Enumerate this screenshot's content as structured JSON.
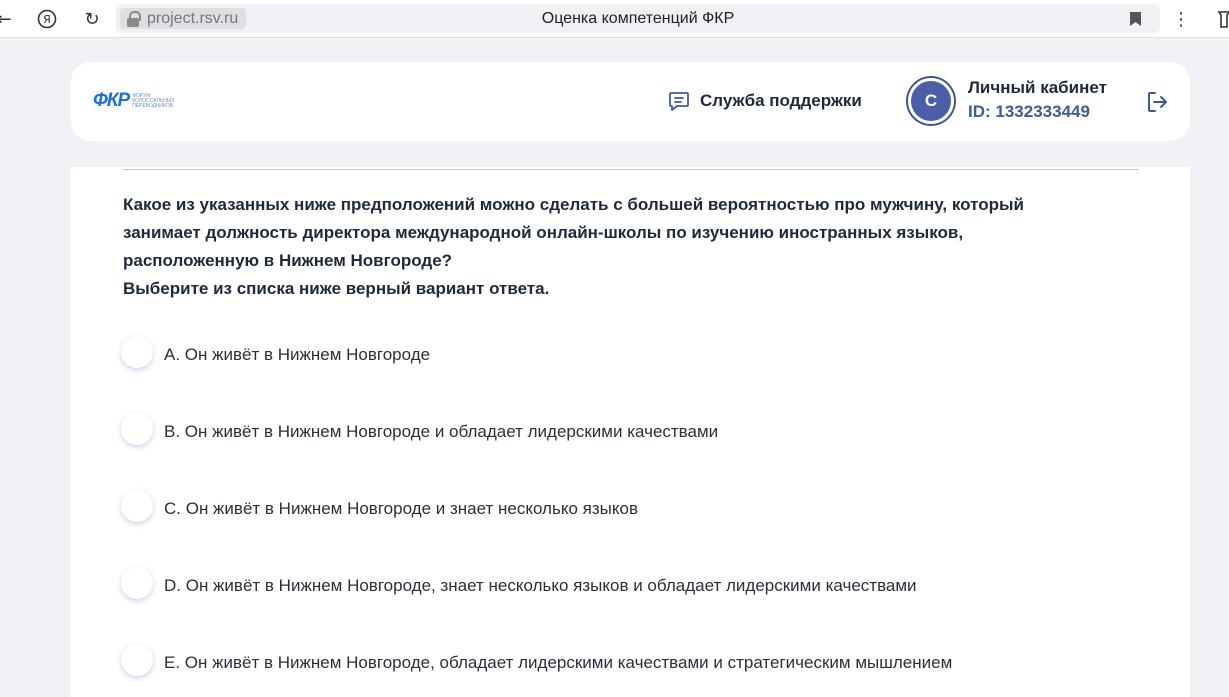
{
  "browser": {
    "url": "project.rsv.ru",
    "tab_title": "Оценка компетенций ФКР"
  },
  "header": {
    "logo_text": "ФКР",
    "logo_subtext": "ФОРУМ КОЛОССАЛЬНЫХ ПЕРЕВОДЧИКОВ",
    "support_label": "Служба поддержки",
    "avatar_letter": "С",
    "cabinet_title": "Личный кабинет",
    "cabinet_id": "ID: 1332333449"
  },
  "question": {
    "text_lines": [
      "Какое из указанных ниже предположений можно сделать с большей вероятностью про мужчину, который",
      "занимает должность директора международной онлайн-школы по изучению иностранных языков,",
      "расположенную в Нижнем Новгороде?",
      "Выберите из списка ниже верный вариант ответа."
    ],
    "options": [
      "А. Он живёт в Нижнем Новгороде",
      "B. Он живёт в Нижнем Новгороде и обладает лидерскими качествами",
      "C. Он живёт в Нижнем Новгороде и знает несколько языков",
      "D. Он живёт в Нижнем Новгороде, знает несколько языков и обладает лидерскими качествами",
      "E. Он живёт в Нижнем Новгороде, обладает лидерскими качествами и стратегическим мышлением"
    ]
  },
  "colors": {
    "accent": "#3d5a9e",
    "logo": "#1e6fd9",
    "page_bg": "#f1f2f6"
  }
}
